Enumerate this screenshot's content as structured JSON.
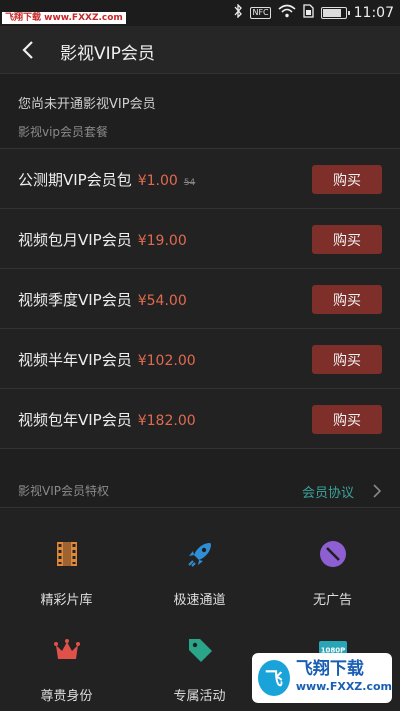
{
  "status_bar": {
    "left_text": "",
    "watermark": "飞翔下载 www.FXXZ.com",
    "time": "11:07",
    "battery_level": 0.75,
    "nfc": "NFC"
  },
  "header": {
    "title": "影视VIP会员"
  },
  "notice": "您尚未开通影视VIP会员",
  "plans_heading": "影视vip会员套餐",
  "plans": [
    {
      "name": "公测期VIP会员包",
      "price": "¥1.00",
      "original": "54",
      "buy": "购买"
    },
    {
      "name": "视频包月VIP会员",
      "price": "¥19.00",
      "original": "",
      "buy": "购买"
    },
    {
      "name": "视频季度VIP会员",
      "price": "¥54.00",
      "original": "",
      "buy": "购买"
    },
    {
      "name": "视频半年VIP会员",
      "price": "¥102.00",
      "original": "",
      "buy": "购买"
    },
    {
      "name": "视频包年VIP会员",
      "price": "¥182.00",
      "original": "",
      "buy": "购买"
    }
  ],
  "privileges": {
    "title": "影视VIP会员特权",
    "link": "会员协议",
    "items": [
      {
        "label": "精彩片库",
        "icon": "film-icon",
        "color": "#e0883a"
      },
      {
        "label": "极速通道",
        "icon": "rocket-icon",
        "color": "#2f8fd6"
      },
      {
        "label": "无广告",
        "icon": "no-ads-icon",
        "color": "#8d5fd3"
      },
      {
        "label": "尊贵身份",
        "icon": "crown-icon",
        "color": "#e0514a"
      },
      {
        "label": "专属活动",
        "icon": "tag-icon",
        "color": "#2aa58a"
      },
      {
        "label": "",
        "icon": "hd-1080p-icon",
        "color": "#2aa5b8",
        "icon_text": "1080P"
      }
    ]
  },
  "watermark_badge": {
    "name": "飞翔下载",
    "url": "www.FXXZ.com",
    "logo_char": "飞"
  }
}
